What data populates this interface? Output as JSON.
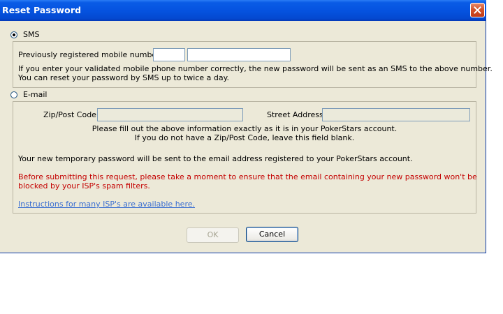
{
  "window": {
    "title": "Reset Password",
    "close_icon": "close-icon"
  },
  "sms": {
    "option_label": "SMS",
    "selected": true,
    "mobile_label": "Previously registered mobile number:",
    "prefix_value": "",
    "number_value": "",
    "info_line1": "If you enter your validated mobile phone number correctly, the new password will be sent as an SMS to the above number.",
    "info_line2": "You can reset your password by SMS up to twice a day."
  },
  "email": {
    "option_label": "E-mail",
    "selected": false,
    "zip_label": "Zip/Post Code:",
    "zip_value": "",
    "street_label": "Street Address:",
    "street_value": "",
    "fill_note_line1": "Please fill out the above information exactly as it is in your PokerStars account.",
    "fill_note_line2": "If you do not have a Zip/Post Code, leave this field blank.",
    "temp_password_note": "Your new temporary password will be sent to the email address registered to your PokerStars account.",
    "warning_line1": "Before submitting this request, please take a moment to ensure that the email containing your new password won't be",
    "warning_line2": "blocked by your ISP's spam filters.",
    "instructions_link": "Instructions for many ISP's are available here."
  },
  "buttons": {
    "ok_label": "OK",
    "cancel_label": "Cancel"
  },
  "colors": {
    "titlebar": "#0553e0",
    "dialog_bg": "#ece9d8",
    "warning": "#c40000",
    "link": "#3b6fd1"
  }
}
